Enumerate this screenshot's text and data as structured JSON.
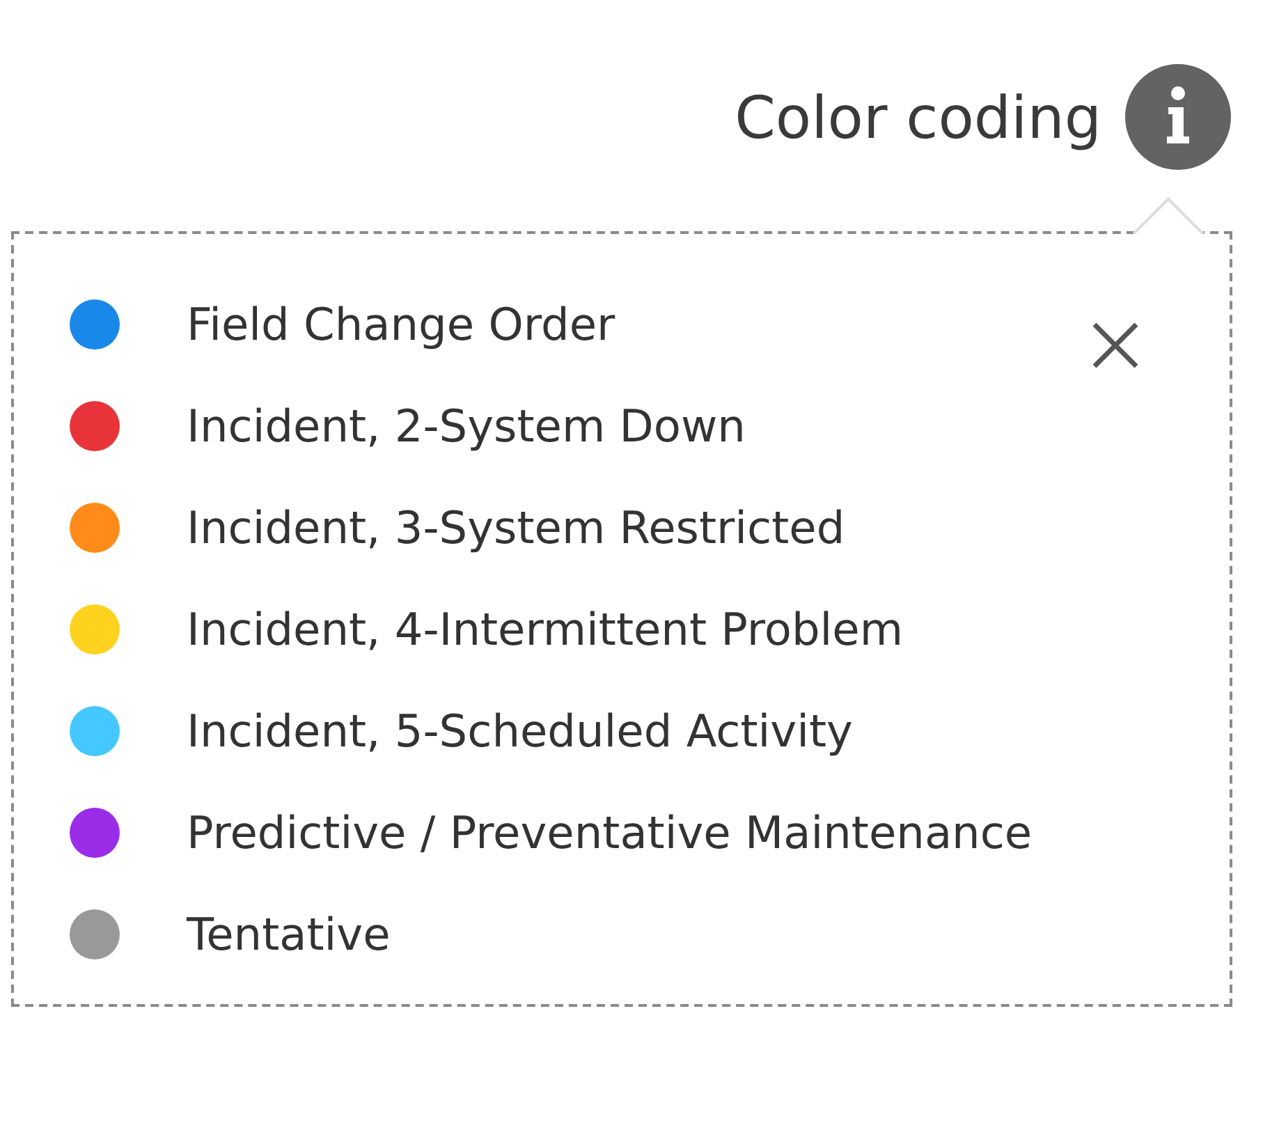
{
  "header": {
    "label": "Color coding"
  },
  "legend": {
    "items": [
      {
        "label": "Field Change Order",
        "color": "#1a88e8"
      },
      {
        "label": "Incident, 2-System Down",
        "color": "#e8343a"
      },
      {
        "label": "Incident, 3-System Restricted",
        "color": "#ff8c1a"
      },
      {
        "label": "Incident, 4-Intermittent Problem",
        "color": "#ffd21f"
      },
      {
        "label": "Incident, 5-Scheduled Activity",
        "color": "#45c8ff"
      },
      {
        "label": "Predictive / Preventative Maintenance",
        "color": "#9b2de8"
      },
      {
        "label": "Tentative",
        "color": "#999999"
      }
    ]
  }
}
